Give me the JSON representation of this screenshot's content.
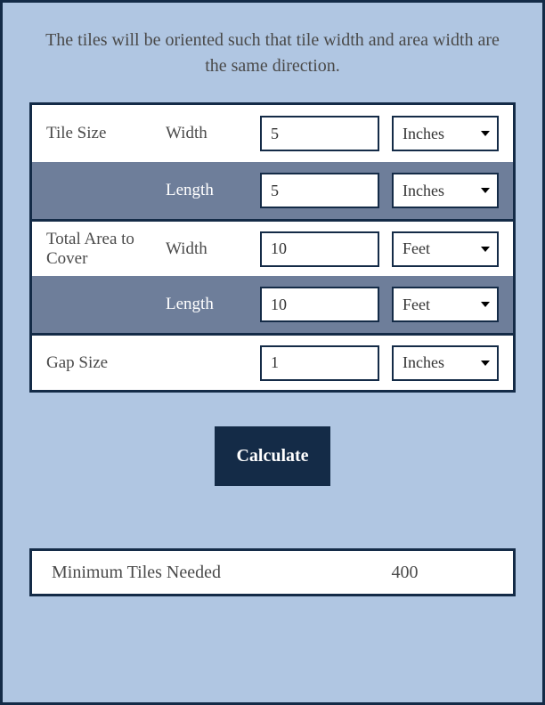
{
  "intro": "The tiles will be oriented such that tile width and area width are the same direction.",
  "form": {
    "tile": {
      "label": "Tile Size",
      "width": {
        "label": "Width",
        "value": "5",
        "unit": "Inches"
      },
      "length": {
        "label": "Length",
        "value": "5",
        "unit": "Inches"
      }
    },
    "area": {
      "label": "Total Area to Cover",
      "width": {
        "label": "Width",
        "value": "10",
        "unit": "Feet"
      },
      "length": {
        "label": "Length",
        "value": "10",
        "unit": "Feet"
      }
    },
    "gap": {
      "label": "Gap Size",
      "value": "1",
      "unit": "Inches"
    }
  },
  "calculate_label": "Calculate",
  "result": {
    "label": "Minimum Tiles Needed",
    "value": "400"
  }
}
